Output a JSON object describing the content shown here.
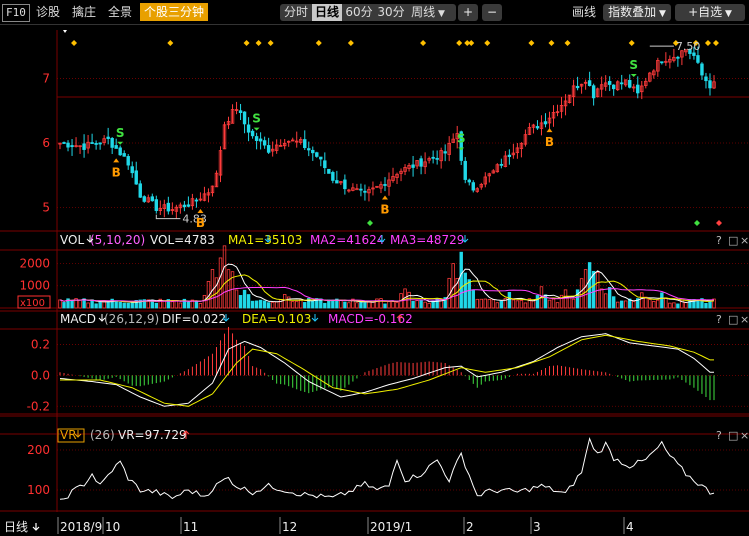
{
  "toolbar": {
    "f10": "F10",
    "items": [
      "诊股",
      "擒庄",
      "全景"
    ],
    "active_item": "个股三分钟",
    "periods": [
      "分时",
      "日线",
      "60分",
      "30分"
    ],
    "active_period": "日线",
    "week_label": "周线",
    "plus": "+",
    "minus": "−",
    "draw_label": "画线",
    "overlay_label": "指数叠加",
    "custom_label": "+自选"
  },
  "colors": {
    "up": "#ff3b3b",
    "down": "#20d8e8",
    "grid": "#7a0000",
    "white_line": "#ffffff",
    "yellow_line": "#f0f000",
    "magenta_line": "#ff40ff",
    "buy_signal": "#ff9a00",
    "sell_signal": "#40e040",
    "diamond": "#ffc000",
    "axis_text": "#ff3030"
  },
  "labels": {
    "price_high": "7.50",
    "price_low": "4.83",
    "buy": "B",
    "sell": "S"
  },
  "vol_header": {
    "name": "VOL",
    "params": "(5,10,20)",
    "vol": "VOL=4783",
    "ma1": "MA1=35103",
    "ma2": "MA2=41624",
    "ma3": "MA3=48729",
    "unit": "x100"
  },
  "macd_header": {
    "name": "MACD",
    "params": "(26,12,9)",
    "dif": "DIF=0.022",
    "dea": "DEA=0.103",
    "macd": "MACD=-0.162"
  },
  "vr_header": {
    "name": "VR",
    "params": "(26)",
    "vr": "VR=97.729"
  },
  "panel_controls": [
    "?",
    "□",
    "×"
  ],
  "bottom_axis": {
    "period": "日线",
    "months": [
      "2018/9",
      "10",
      "11",
      "12",
      "2019/1",
      "2",
      "3",
      "4"
    ]
  },
  "chart_data": [
    {
      "type": "candlestick",
      "title": "",
      "ylim": [
        4.7,
        7.75
      ],
      "yticks": [
        5,
        6,
        7
      ],
      "anchor_path": [
        [
          0,
          6.0
        ],
        [
          6,
          5.95
        ],
        [
          12,
          6.05
        ],
        [
          15,
          5.85
        ],
        [
          17,
          5.7
        ],
        [
          20,
          5.2
        ],
        [
          24,
          5.0
        ],
        [
          28,
          4.98
        ],
        [
          33,
          5.08
        ],
        [
          37,
          5.25
        ],
        [
          39,
          5.5
        ],
        [
          41,
          6.3
        ],
        [
          44,
          6.55
        ],
        [
          46,
          6.3
        ],
        [
          48,
          6.1
        ],
        [
          52,
          5.9
        ],
        [
          56,
          6.05
        ],
        [
          60,
          6.0
        ],
        [
          64,
          5.8
        ],
        [
          68,
          5.45
        ],
        [
          72,
          5.3
        ],
        [
          76,
          5.2
        ],
        [
          80,
          5.35
        ],
        [
          84,
          5.55
        ],
        [
          88,
          5.65
        ],
        [
          92,
          5.75
        ],
        [
          96,
          5.85
        ],
        [
          99,
          6.15
        ],
        [
          101,
          5.4
        ],
        [
          103,
          5.3
        ],
        [
          108,
          5.55
        ],
        [
          113,
          5.9
        ],
        [
          117,
          6.2
        ],
        [
          121,
          6.35
        ],
        [
          125,
          6.6
        ],
        [
          128,
          6.85
        ],
        [
          131,
          7.0
        ],
        [
          133,
          6.75
        ],
        [
          135,
          6.95
        ],
        [
          138,
          6.9
        ],
        [
          141,
          6.95
        ],
        [
          144,
          6.75
        ],
        [
          147,
          7.1
        ],
        [
          150,
          7.3
        ],
        [
          153,
          7.35
        ],
        [
          156,
          7.45
        ],
        [
          158,
          7.35
        ],
        [
          160,
          7.05
        ],
        [
          162,
          6.9
        ]
      ],
      "high": 7.5,
      "low": 4.83,
      "buy_signals_at_index": [
        14,
        35,
        81,
        122
      ],
      "sell_signals_at_index": [
        15,
        49,
        100,
        143
      ]
    },
    {
      "type": "bar",
      "title": "VOL",
      "series": [
        {
          "name": "VOL"
        },
        {
          "name": "MA1"
        },
        {
          "name": "MA2"
        },
        {
          "name": "MA3"
        }
      ],
      "ylim": [
        0,
        2600
      ],
      "yticks": [
        1000,
        2000
      ],
      "spikes": [
        [
          38,
          1750
        ],
        [
          40,
          2200
        ],
        [
          41,
          2550
        ],
        [
          43,
          1500
        ],
        [
          46,
          900
        ],
        [
          56,
          700
        ],
        [
          70,
          300
        ],
        [
          86,
          1000
        ],
        [
          90,
          400
        ],
        [
          98,
          1900
        ],
        [
          100,
          2350
        ],
        [
          102,
          1200
        ],
        [
          112,
          700
        ],
        [
          120,
          1000
        ],
        [
          126,
          800
        ],
        [
          130,
          1350
        ],
        [
          132,
          2450
        ],
        [
          134,
          1500
        ],
        [
          137,
          900
        ],
        [
          145,
          700
        ],
        [
          150,
          650
        ]
      ]
    },
    {
      "type": "line",
      "title": "MACD",
      "series": [
        {
          "name": "DIF"
        },
        {
          "name": "DEA"
        },
        {
          "name": "MACD"
        }
      ],
      "ylim": [
        -0.25,
        0.3
      ],
      "yticks": [
        -0.2,
        0.0,
        0.2
      ],
      "dif_anchor_path": [
        [
          0,
          -0.02
        ],
        [
          8,
          -0.04
        ],
        [
          14,
          -0.06
        ],
        [
          20,
          -0.14
        ],
        [
          26,
          -0.2
        ],
        [
          32,
          -0.18
        ],
        [
          38,
          -0.05
        ],
        [
          42,
          0.17
        ],
        [
          46,
          0.22
        ],
        [
          50,
          0.18
        ],
        [
          56,
          0.08
        ],
        [
          62,
          -0.04
        ],
        [
          70,
          -0.14
        ],
        [
          76,
          -0.11
        ],
        [
          82,
          -0.06
        ],
        [
          88,
          -0.02
        ],
        [
          96,
          0.05
        ],
        [
          100,
          0.06
        ],
        [
          104,
          -0.01
        ],
        [
          110,
          0.02
        ],
        [
          118,
          0.09
        ],
        [
          124,
          0.18
        ],
        [
          130,
          0.25
        ],
        [
          136,
          0.27
        ],
        [
          142,
          0.21
        ],
        [
          148,
          0.19
        ],
        [
          154,
          0.17
        ],
        [
          158,
          0.11
        ],
        [
          162,
          0.02
        ]
      ],
      "dea_anchor_path": [
        [
          0,
          -0.03
        ],
        [
          10,
          -0.03
        ],
        [
          18,
          -0.08
        ],
        [
          26,
          -0.18
        ],
        [
          32,
          -0.2
        ],
        [
          38,
          -0.12
        ],
        [
          44,
          0.08
        ],
        [
          48,
          0.17
        ],
        [
          54,
          0.14
        ],
        [
          60,
          0.05
        ],
        [
          68,
          -0.08
        ],
        [
          76,
          -0.12
        ],
        [
          84,
          -0.09
        ],
        [
          92,
          -0.03
        ],
        [
          100,
          0.05
        ],
        [
          106,
          0.02
        ],
        [
          114,
          0.05
        ],
        [
          122,
          0.12
        ],
        [
          130,
          0.23
        ],
        [
          136,
          0.26
        ],
        [
          144,
          0.22
        ],
        [
          152,
          0.19
        ],
        [
          158,
          0.15
        ],
        [
          162,
          0.1
        ]
      ]
    },
    {
      "type": "line",
      "title": "VR",
      "series": [
        {
          "name": "VR"
        }
      ],
      "ylim": [
        50,
        240
      ],
      "yticks": [
        100,
        200
      ],
      "anchor_path": [
        [
          0,
          70
        ],
        [
          3,
          95
        ],
        [
          6,
          115
        ],
        [
          8,
          140
        ],
        [
          10,
          110
        ],
        [
          13,
          150
        ],
        [
          15,
          170
        ],
        [
          17,
          130
        ],
        [
          20,
          100
        ],
        [
          24,
          95
        ],
        [
          28,
          80
        ],
        [
          32,
          100
        ],
        [
          36,
          85
        ],
        [
          40,
          120
        ],
        [
          42,
          130
        ],
        [
          44,
          110
        ],
        [
          48,
          95
        ],
        [
          52,
          110
        ],
        [
          56,
          100
        ],
        [
          60,
          90
        ],
        [
          64,
          85
        ],
        [
          68,
          80
        ],
        [
          72,
          95
        ],
        [
          76,
          115
        ],
        [
          79,
          100
        ],
        [
          82,
          110
        ],
        [
          84,
          180
        ],
        [
          86,
          125
        ],
        [
          90,
          140
        ],
        [
          94,
          175
        ],
        [
          97,
          125
        ],
        [
          100,
          190
        ],
        [
          104,
          85
        ],
        [
          106,
          95
        ],
        [
          110,
          100
        ],
        [
          114,
          95
        ],
        [
          120,
          110
        ],
        [
          126,
          90
        ],
        [
          130,
          145
        ],
        [
          132,
          225
        ],
        [
          134,
          190
        ],
        [
          136,
          215
        ],
        [
          138,
          180
        ],
        [
          142,
          160
        ],
        [
          146,
          175
        ],
        [
          150,
          215
        ],
        [
          152,
          185
        ],
        [
          156,
          140
        ],
        [
          160,
          110
        ],
        [
          162,
          95
        ]
      ]
    }
  ]
}
